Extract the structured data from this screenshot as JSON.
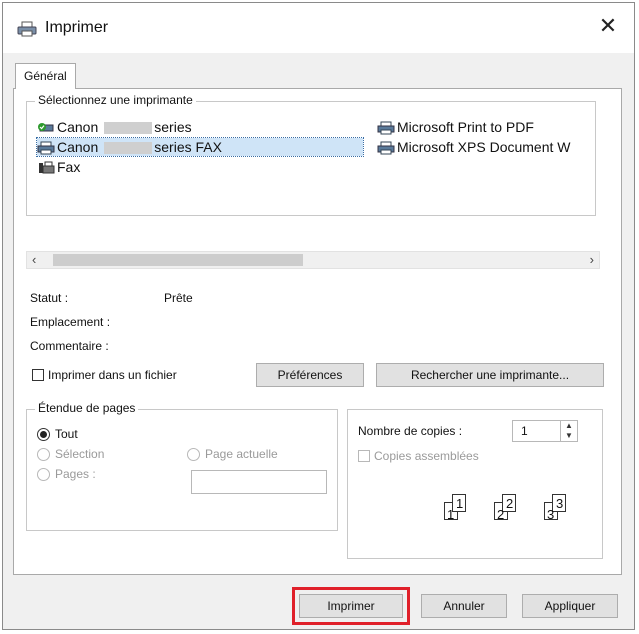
{
  "window": {
    "title": "Imprimer",
    "close_glyph": "✕"
  },
  "tabs": [
    {
      "label": "Général"
    }
  ],
  "printers_group": {
    "legend": "Sélectionnez une imprimante",
    "items": [
      {
        "prefix": "Canon",
        "suffix": "series",
        "icon": "printer-ready-icon"
      },
      {
        "prefix": "Canon",
        "suffix": "series FAX",
        "icon": "printer-icon",
        "selected": true
      },
      {
        "prefix": "Fax",
        "suffix": "",
        "icon": "fax-icon"
      },
      {
        "prefix": "Microsoft Print to PDF",
        "suffix": "",
        "icon": "printer-icon"
      },
      {
        "prefix": "Microsoft XPS Document W",
        "suffix": "",
        "icon": "printer-icon"
      }
    ]
  },
  "status": {
    "status_label": "Statut :",
    "status_value": "Prête",
    "location_label": "Emplacement :",
    "comment_label": "Commentaire :"
  },
  "print_to_file": {
    "label": "Imprimer dans un fichier",
    "checked": false
  },
  "buttons": {
    "preferences": "Préférences",
    "find_printer": "Rechercher une imprimante...",
    "print": "Imprimer",
    "cancel": "Annuler",
    "apply": "Appliquer"
  },
  "page_range": {
    "legend": "Étendue de pages",
    "all": "Tout",
    "selection": "Sélection",
    "current_page": "Page actuelle",
    "pages": "Pages :",
    "pages_value": ""
  },
  "copies": {
    "count_label": "Nombre de copies :",
    "count_value": "1",
    "collate_label": "Copies assemblées",
    "collate_checked": false,
    "collate_pages": [
      "1",
      "1",
      "2",
      "2",
      "3",
      "3"
    ]
  },
  "colors": {
    "selection": "#cfe4f7",
    "highlight": "#e0202a",
    "dialog_bg": "#f0f0f0"
  }
}
